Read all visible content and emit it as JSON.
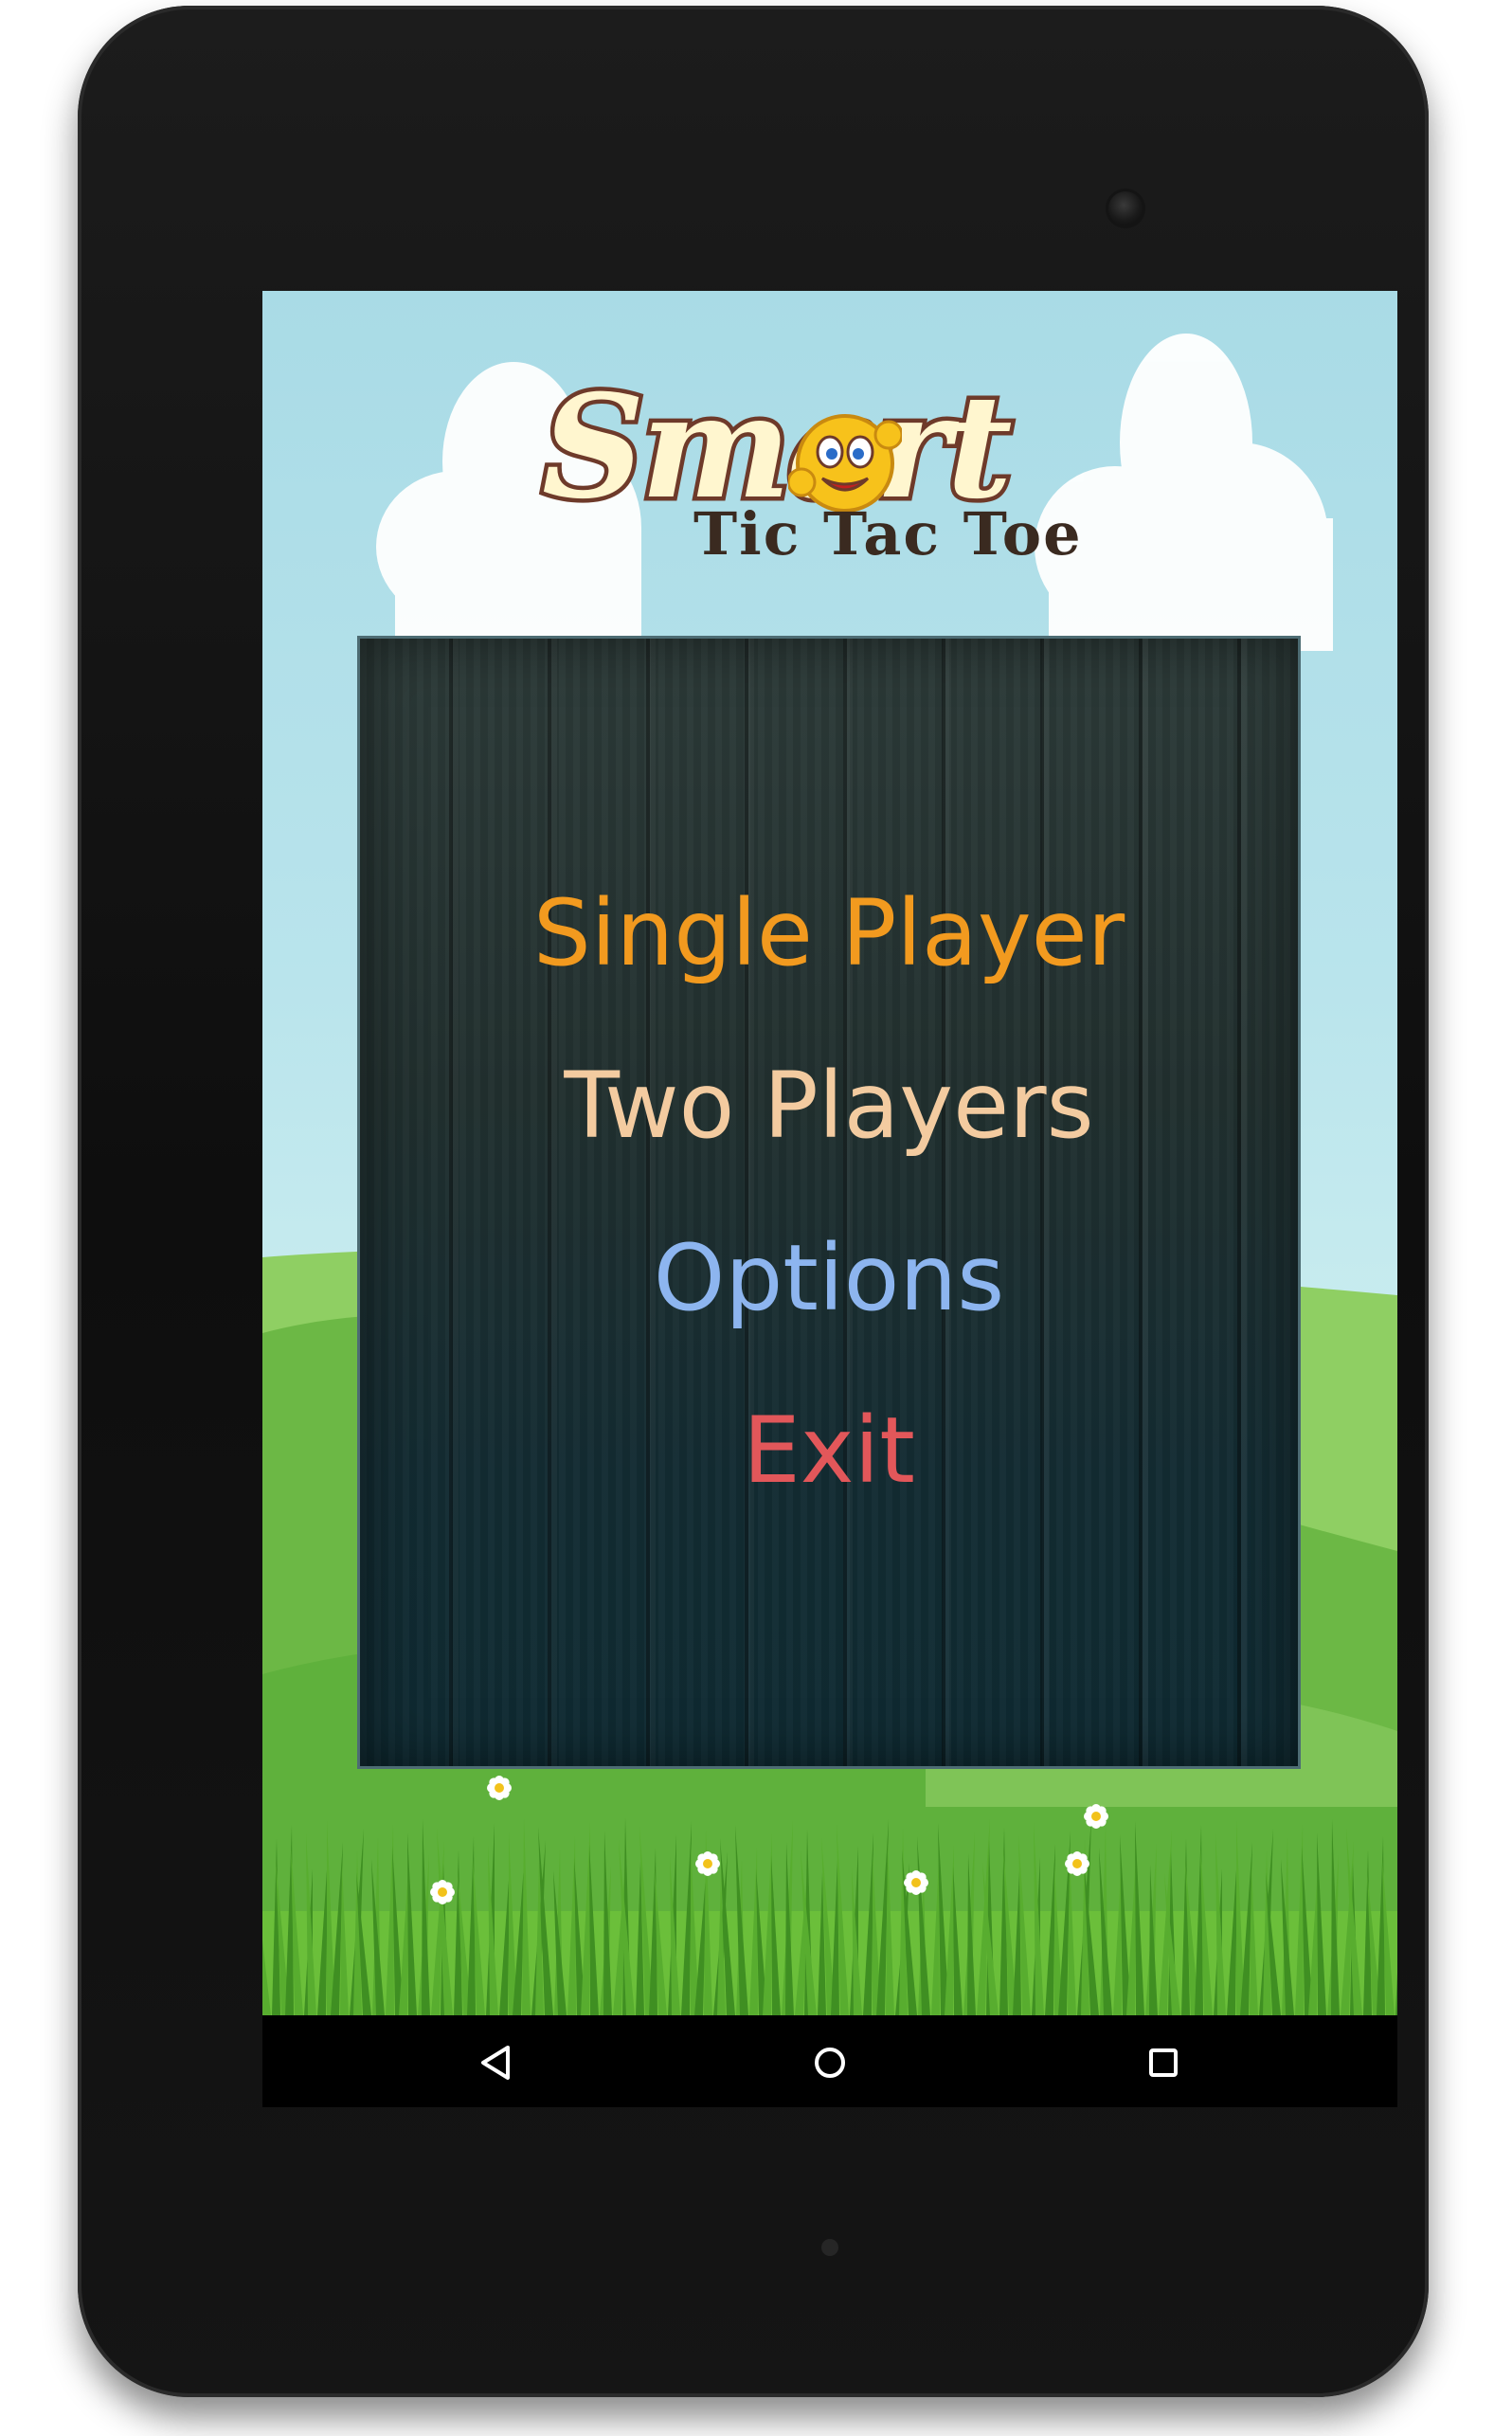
{
  "app": {
    "logo_title": "Smart",
    "logo_subtitle": "Tic Tac Toe"
  },
  "menu": {
    "items": [
      {
        "label": "Single Player",
        "color": "#f29a1f"
      },
      {
        "label": "Two Players",
        "color": "#f3cba0"
      },
      {
        "label": "Options",
        "color": "#8db5ef"
      },
      {
        "label": "Exit",
        "color": "#e2575a"
      }
    ]
  },
  "navbar": {
    "icons": [
      "back-icon",
      "home-icon",
      "recent-apps-icon"
    ]
  },
  "colors": {
    "sky": "#a9dbe6",
    "hill": "#7cc04e",
    "grass": "#4fa72c",
    "panel": "#1e3535"
  }
}
